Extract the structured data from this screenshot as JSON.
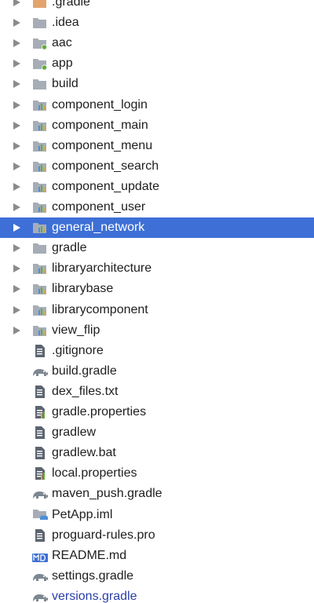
{
  "items": [
    {
      "label": ".gradle",
      "icon": "folder-orange-icon",
      "expandable": true
    },
    {
      "label": ".idea",
      "icon": "folder-icon",
      "expandable": true
    },
    {
      "label": "aac",
      "icon": "module-folder-icon",
      "expandable": true
    },
    {
      "label": "app",
      "icon": "module-folder-icon",
      "expandable": true
    },
    {
      "label": "build",
      "icon": "folder-icon",
      "expandable": true
    },
    {
      "label": "component_login",
      "icon": "library-folder-icon",
      "expandable": true
    },
    {
      "label": "component_main",
      "icon": "library-folder-icon",
      "expandable": true
    },
    {
      "label": "component_menu",
      "icon": "library-folder-icon",
      "expandable": true
    },
    {
      "label": "component_search",
      "icon": "library-folder-icon",
      "expandable": true
    },
    {
      "label": "component_update",
      "icon": "library-folder-icon",
      "expandable": true
    },
    {
      "label": "component_user",
      "icon": "library-folder-icon",
      "expandable": true
    },
    {
      "label": "general_network",
      "icon": "library-folder-icon",
      "expandable": true,
      "selected": true
    },
    {
      "label": "gradle",
      "icon": "folder-icon",
      "expandable": true
    },
    {
      "label": "libraryarchitecture",
      "icon": "library-folder-icon",
      "expandable": true
    },
    {
      "label": "librarybase",
      "icon": "library-folder-icon",
      "expandable": true
    },
    {
      "label": "librarycomponent",
      "icon": "library-folder-icon",
      "expandable": true
    },
    {
      "label": "view_flip",
      "icon": "library-folder-icon",
      "expandable": true
    },
    {
      "label": ".gitignore",
      "icon": "text-file-icon"
    },
    {
      "label": "build.gradle",
      "icon": "gradle-elephant-icon"
    },
    {
      "label": "dex_files.txt",
      "icon": "text-file-icon"
    },
    {
      "label": "gradle.properties",
      "icon": "properties-file-icon"
    },
    {
      "label": "gradlew",
      "icon": "text-file-icon"
    },
    {
      "label": "gradlew.bat",
      "icon": "text-file-icon"
    },
    {
      "label": "local.properties",
      "icon": "properties-file-icon"
    },
    {
      "label": "maven_push.gradle",
      "icon": "gradle-elephant-icon"
    },
    {
      "label": "PetApp.iml",
      "icon": "iml-module-icon"
    },
    {
      "label": "proguard-rules.pro",
      "icon": "text-file-icon"
    },
    {
      "label": "README.md",
      "icon": "markdown-file-icon",
      "badge": "MD"
    },
    {
      "label": "settings.gradle",
      "icon": "gradle-elephant-icon"
    },
    {
      "label": "versions.gradle",
      "icon": "gradle-elephant-icon",
      "vcs_new": true
    }
  ],
  "colors": {
    "selection": "#3d6fd6",
    "folder": "#a6adb6",
    "folder_orange": "#e2a36d",
    "module_dot": "#5fae3b",
    "vcs_new_text": "#2a3fa8"
  }
}
